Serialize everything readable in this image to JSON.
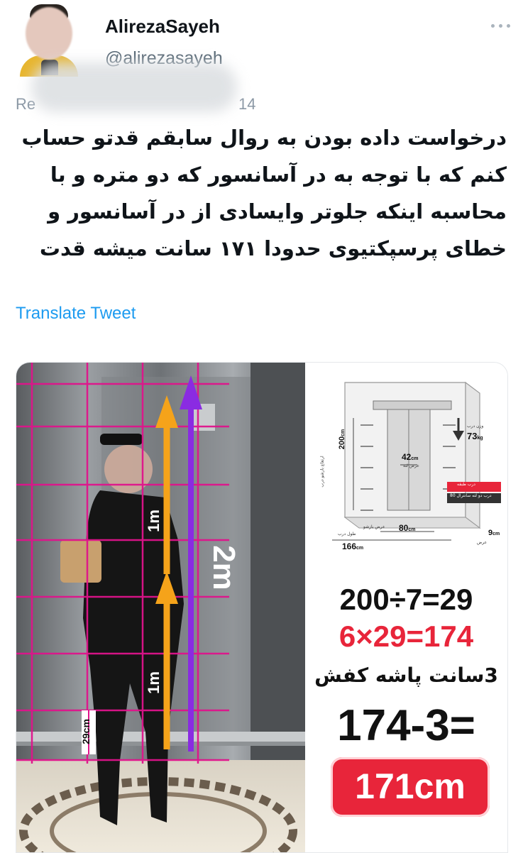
{
  "author": {
    "display_name": "AlirezaSayeh",
    "handle": "@alirezasayeh"
  },
  "reply_line": {
    "prefix": "Re",
    "suffix": "14"
  },
  "tweet": {
    "text": "درخواست داده بودن به روال سابقم قدتو حساب کنم که با توجه به در آسانسور که دو متره و با محاسبه اینکه جلوتر وایسادی از در آسانسور و خطای پرسپکتیوی حدودا ۱۷۱ سانت میشه قدت",
    "translate_label": "Translate Tweet"
  },
  "media": {
    "photo": {
      "label_1m_top": "1m",
      "label_1m_bottom": "1m",
      "label_2m": "2m",
      "label_29cm": "29cm"
    },
    "diagram": {
      "height_label": "200",
      "height_unit": "cm",
      "opening_label": "42",
      "opening_unit": "cm",
      "opening_caption": "عرض لته",
      "weight_label": "73",
      "weight_unit": "kg",
      "weight_caption": "وزن درب",
      "width_inner_label": "80",
      "width_inner_unit": "cm",
      "width_inner_caption": "عرض بازشو",
      "width_outer_label": "166",
      "width_outer_unit": "cm",
      "width_outer_caption": "طول درب",
      "depth_label": "9",
      "depth_unit": "cm",
      "depth_caption": "عرض",
      "side_caption": "ارتفاع بازشو درب",
      "legend_1": "درب طبقه",
      "legend_2": "درب دو لته سانترال 80"
    },
    "calc": {
      "line_1": "200÷7=29",
      "line_2": "6×29=174",
      "line_3": "3سانت پاشه کفش",
      "line_4": "174-3=",
      "result": "171cm"
    },
    "colors": {
      "grid": "#e0138c",
      "arrow_orange": "#f5a31a",
      "arrow_purple": "#8a2be2",
      "result_bg": "#e8253a",
      "red_text": "#e8253a"
    }
  }
}
